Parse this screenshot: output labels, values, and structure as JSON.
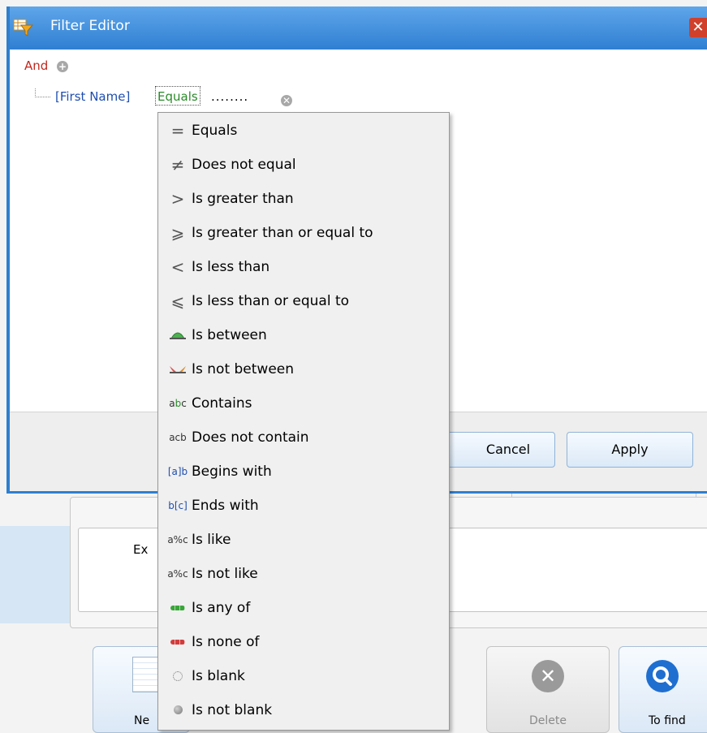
{
  "window": {
    "title": "Filter Editor",
    "close_glyph": "✕"
  },
  "filter_tree": {
    "group_operator": "And",
    "condition": {
      "field": "[First Name]",
      "operator": "Equals",
      "value": "........"
    }
  },
  "dialog_buttons": {
    "cancel_label": "Cancel",
    "apply_label": "Apply"
  },
  "operator_menu": {
    "items": [
      {
        "label": "Equals",
        "icon": "equals-icon",
        "glyph": "="
      },
      {
        "label": "Does not equal",
        "icon": "not-equal-icon",
        "glyph": "≠"
      },
      {
        "label": "Is greater than",
        "icon": "greater-than-icon",
        "glyph": ">"
      },
      {
        "label": "Is greater than or equal to",
        "icon": "greater-equal-icon",
        "glyph": "⩾"
      },
      {
        "label": "Is less than",
        "icon": "less-than-icon",
        "glyph": "<"
      },
      {
        "label": "Is less than or equal to",
        "icon": "less-equal-icon",
        "glyph": "⩽"
      },
      {
        "label": "Is between",
        "icon": "between-icon",
        "glyph": ""
      },
      {
        "label": "Is not between",
        "icon": "not-between-icon",
        "glyph": ""
      },
      {
        "label": "Contains",
        "icon": "contains-icon",
        "glyph": "abc"
      },
      {
        "label": "Does not contain",
        "icon": "not-contains-icon",
        "glyph": "acb"
      },
      {
        "label": "Begins with",
        "icon": "begins-with-icon",
        "glyph": "[a]b"
      },
      {
        "label": "Ends with",
        "icon": "ends-with-icon",
        "glyph": "b[c]"
      },
      {
        "label": "Is like",
        "icon": "like-icon",
        "glyph": "a%c"
      },
      {
        "label": "Is not like",
        "icon": "not-like-icon",
        "glyph": "a%c"
      },
      {
        "label": "Is any of",
        "icon": "any-of-icon",
        "glyph": ""
      },
      {
        "label": "Is none of",
        "icon": "none-of-icon",
        "glyph": ""
      },
      {
        "label": "Is blank",
        "icon": "blank-icon",
        "glyph": ""
      },
      {
        "label": "Is not blank",
        "icon": "not-blank-icon",
        "glyph": ""
      }
    ]
  },
  "background": {
    "label_partial": "Ex",
    "buttons": [
      {
        "label": "Ne",
        "icon": "new-document-icon"
      },
      {
        "label": "Delete",
        "icon": "delete-icon"
      },
      {
        "label": "To find",
        "icon": "search-icon"
      }
    ]
  },
  "colors": {
    "title_bar": "#3f8fdc",
    "group_operator": "#c0281e",
    "field": "#1f4eb0",
    "operator": "#2a8a2a",
    "any_of": "#3aa53a",
    "none_of": "#d23c3c"
  }
}
